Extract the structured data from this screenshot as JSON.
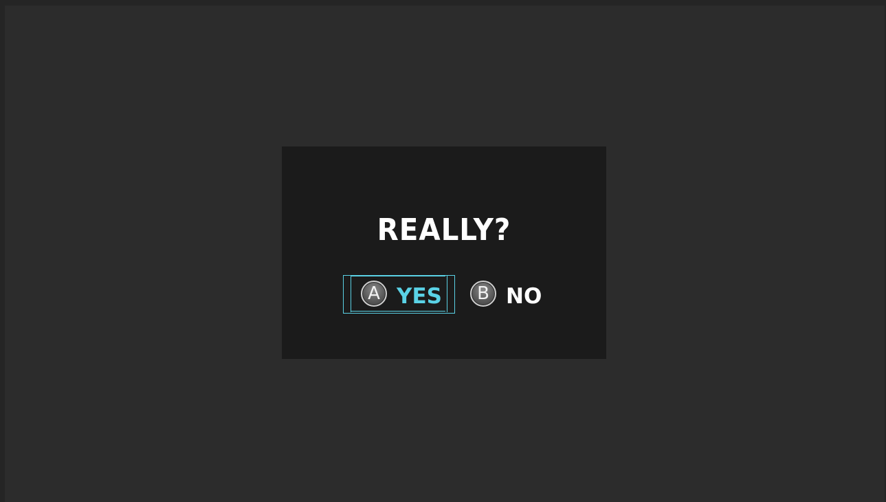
{
  "dialog": {
    "title": "REALLY?",
    "options": [
      {
        "button": "A",
        "label": "YES",
        "selected": true
      },
      {
        "button": "B",
        "label": "NO",
        "selected": false
      }
    ]
  },
  "colors": {
    "background": "#2c2c2c",
    "dialog_background": "#1b1b1b",
    "highlight": "#5ad2e6",
    "text": "#ffffff"
  }
}
